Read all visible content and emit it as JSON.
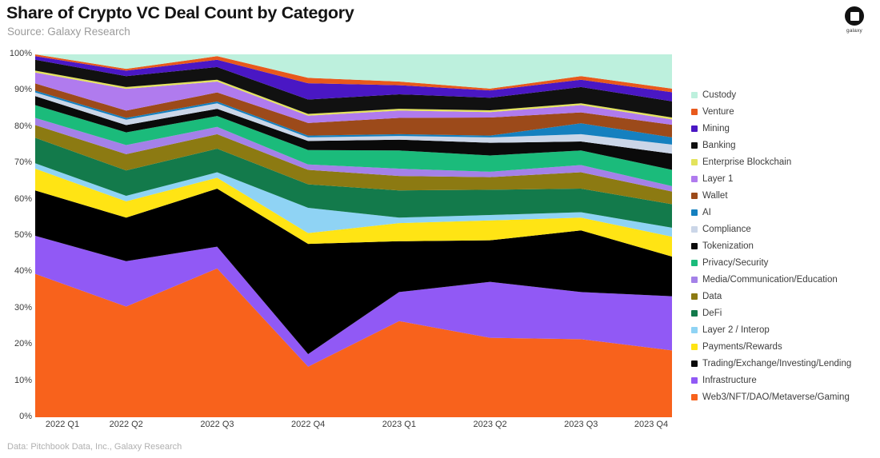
{
  "header": {
    "title": "Share of Crypto VC Deal Count by Category",
    "subtitle": "Source: Galaxy Research"
  },
  "logo": {
    "name": "galaxy-logo",
    "text": "galaxy"
  },
  "footer": {
    "text": "Data: Pitchbook Data, Inc., Galaxy Research"
  },
  "chart_data": {
    "type": "area",
    "stacked": true,
    "normalized": true,
    "title": "Share of Crypto VC Deal Count by Category",
    "subtitle": "Source: Galaxy Research",
    "xlabel": "",
    "ylabel": "",
    "ylim": [
      0,
      100
    ],
    "yticks": [
      "0%",
      "10%",
      "20%",
      "30%",
      "40%",
      "50%",
      "60%",
      "70%",
      "80%",
      "90%",
      "100%"
    ],
    "ytick_values": [
      0,
      10,
      20,
      30,
      40,
      50,
      60,
      70,
      80,
      90,
      100
    ],
    "grid": false,
    "legend_position": "right",
    "categories": [
      "2022 Q1",
      "2022 Q2",
      "2022 Q3",
      "2022 Q4",
      "2023 Q1",
      "2023 Q2",
      "2023 Q3",
      "2023 Q4"
    ],
    "series": [
      {
        "name": "Web3/NFT/DAO/Metaverse/Gaming",
        "color": "#F8621C",
        "values": [
          39.5,
          30.5,
          41.0,
          14.0,
          26.5,
          22.0,
          21.5,
          18.5
        ]
      },
      {
        "name": "Infrastructure",
        "color": "#9159F5",
        "values": [
          10.5,
          12.5,
          6.0,
          3.5,
          8.0,
          15.5,
          13.0,
          15.0
        ]
      },
      {
        "name": "Trading/Exchange/Investing/Lending",
        "color": "#000000",
        "values": [
          12.5,
          12.0,
          16.0,
          30.5,
          14.0,
          11.5,
          17.0,
          11.0
        ]
      },
      {
        "name": "Payments/Rewards",
        "color": "#FFE414",
        "values": [
          6.0,
          4.5,
          3.0,
          3.0,
          5.0,
          5.5,
          3.5,
          5.5
        ]
      },
      {
        "name": "Layer 2 / Interop",
        "color": "#8FD3F4",
        "values": [
          1.5,
          1.5,
          1.5,
          7.0,
          1.5,
          1.5,
          1.5,
          2.5
        ]
      },
      {
        "name": "DeFi",
        "color": "#137A4B",
        "values": [
          7.0,
          7.0,
          6.5,
          6.5,
          7.5,
          7.0,
          6.5,
          6.5
        ]
      },
      {
        "name": "Data",
        "color": "#8C7A12",
        "values": [
          3.5,
          4.5,
          4.0,
          4.0,
          4.0,
          3.5,
          4.5,
          3.5
        ]
      },
      {
        "name": "Media/Communication/Education",
        "color": "#A481E8",
        "values": [
          2.0,
          2.5,
          2.0,
          1.5,
          2.0,
          1.5,
          2.0,
          1.5
        ]
      },
      {
        "name": "Privacy/Security",
        "color": "#1BBB7B",
        "values": [
          3.5,
          3.5,
          3.0,
          4.0,
          5.0,
          4.5,
          4.0,
          4.5
        ]
      },
      {
        "name": "Tokenization",
        "color": "#0A0A0A",
        "values": [
          2.5,
          2.0,
          2.0,
          2.5,
          3.0,
          3.5,
          2.5,
          4.5
        ]
      },
      {
        "name": "Compliance",
        "color": "#CBD6E8",
        "values": [
          1.0,
          1.5,
          1.5,
          1.0,
          1.0,
          1.5,
          2.0,
          2.5
        ]
      },
      {
        "name": "AI",
        "color": "#1580BF",
        "values": [
          0.5,
          0.5,
          0.5,
          0.5,
          0.5,
          0.5,
          3.0,
          2.0
        ]
      },
      {
        "name": "Wallet",
        "color": "#9C4A1A",
        "values": [
          2.0,
          2.0,
          2.5,
          3.5,
          4.5,
          5.0,
          3.0,
          3.5
        ]
      },
      {
        "name": "Layer 1",
        "color": "#B07BEE",
        "values": [
          3.0,
          6.0,
          3.0,
          2.0,
          2.0,
          1.5,
          2.0,
          1.5
        ]
      },
      {
        "name": "Enterprise Blockchain",
        "color": "#E3E35C",
        "values": [
          0.5,
          0.5,
          0.5,
          0.5,
          0.5,
          0.5,
          0.5,
          0.5
        ]
      },
      {
        "name": "Banking",
        "color": "#111111",
        "values": [
          3.0,
          3.0,
          3.5,
          4.0,
          4.0,
          3.5,
          4.5,
          4.5
        ]
      },
      {
        "name": "Mining",
        "color": "#4A17C4",
        "values": [
          1.0,
          1.5,
          2.0,
          4.5,
          2.5,
          2.0,
          2.0,
          2.5
        ]
      },
      {
        "name": "Venture",
        "color": "#E8591C",
        "values": [
          0.5,
          0.5,
          1.0,
          1.5,
          1.0,
          0.5,
          1.0,
          1.0
        ]
      },
      {
        "name": "Custody",
        "color": "#BDF0DD",
        "values": [
          0.0,
          4.0,
          0.5,
          6.5,
          7.5,
          9.5,
          6.0,
          9.5
        ]
      }
    ]
  },
  "legend": {
    "items": [
      {
        "label": "Custody",
        "color": "#BDF0DD"
      },
      {
        "label": "Venture",
        "color": "#E8591C"
      },
      {
        "label": "Mining",
        "color": "#4A17C4"
      },
      {
        "label": "Banking",
        "color": "#111111"
      },
      {
        "label": "Enterprise Blockchain",
        "color": "#E3E35C"
      },
      {
        "label": "Layer 1",
        "color": "#B07BEE"
      },
      {
        "label": "Wallet",
        "color": "#9C4A1A"
      },
      {
        "label": "AI",
        "color": "#1580BF"
      },
      {
        "label": "Compliance",
        "color": "#CBD6E8"
      },
      {
        "label": "Tokenization",
        "color": "#0A0A0A"
      },
      {
        "label": "Privacy/Security",
        "color": "#1BBB7B"
      },
      {
        "label": "Media/Communication/Education",
        "color": "#A481E8"
      },
      {
        "label": "Data",
        "color": "#8C7A12"
      },
      {
        "label": "DeFi",
        "color": "#137A4B"
      },
      {
        "label": "Layer 2 / Interop",
        "color": "#8FD3F4"
      },
      {
        "label": "Payments/Rewards",
        "color": "#FFE414"
      },
      {
        "label": "Trading/Exchange/Investing/Lending",
        "color": "#0A0A0A"
      },
      {
        "label": "Infrastructure",
        "color": "#9159F5"
      },
      {
        "label": "Web3/NFT/DAO/Metaverse/Gaming",
        "color": "#F8621C"
      }
    ]
  }
}
